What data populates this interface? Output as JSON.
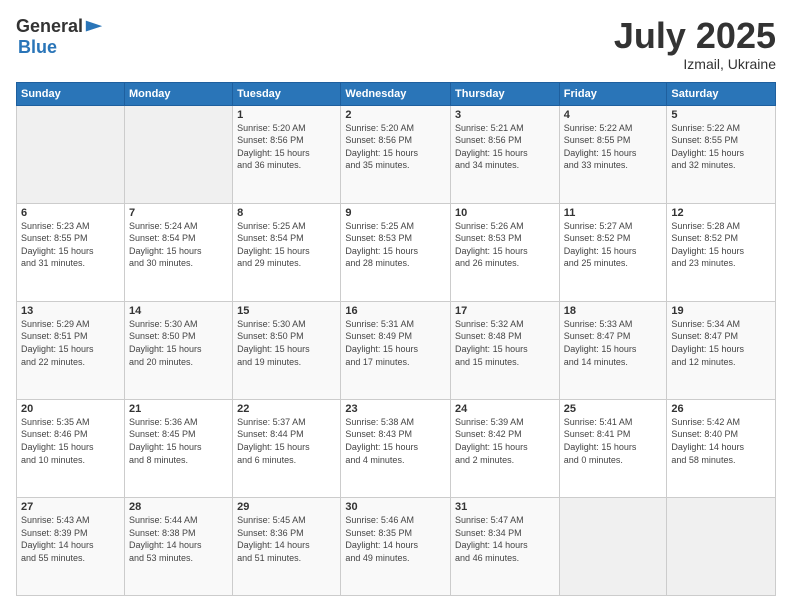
{
  "header": {
    "logo_general": "General",
    "logo_blue": "Blue",
    "title": "July 2025",
    "location": "Izmail, Ukraine"
  },
  "calendar": {
    "days_header": [
      "Sunday",
      "Monday",
      "Tuesday",
      "Wednesday",
      "Thursday",
      "Friday",
      "Saturday"
    ],
    "weeks": [
      [
        {
          "day": "",
          "info": ""
        },
        {
          "day": "",
          "info": ""
        },
        {
          "day": "1",
          "info": "Sunrise: 5:20 AM\nSunset: 8:56 PM\nDaylight: 15 hours\nand 36 minutes."
        },
        {
          "day": "2",
          "info": "Sunrise: 5:20 AM\nSunset: 8:56 PM\nDaylight: 15 hours\nand 35 minutes."
        },
        {
          "day": "3",
          "info": "Sunrise: 5:21 AM\nSunset: 8:56 PM\nDaylight: 15 hours\nand 34 minutes."
        },
        {
          "day": "4",
          "info": "Sunrise: 5:22 AM\nSunset: 8:55 PM\nDaylight: 15 hours\nand 33 minutes."
        },
        {
          "day": "5",
          "info": "Sunrise: 5:22 AM\nSunset: 8:55 PM\nDaylight: 15 hours\nand 32 minutes."
        }
      ],
      [
        {
          "day": "6",
          "info": "Sunrise: 5:23 AM\nSunset: 8:55 PM\nDaylight: 15 hours\nand 31 minutes."
        },
        {
          "day": "7",
          "info": "Sunrise: 5:24 AM\nSunset: 8:54 PM\nDaylight: 15 hours\nand 30 minutes."
        },
        {
          "day": "8",
          "info": "Sunrise: 5:25 AM\nSunset: 8:54 PM\nDaylight: 15 hours\nand 29 minutes."
        },
        {
          "day": "9",
          "info": "Sunrise: 5:25 AM\nSunset: 8:53 PM\nDaylight: 15 hours\nand 28 minutes."
        },
        {
          "day": "10",
          "info": "Sunrise: 5:26 AM\nSunset: 8:53 PM\nDaylight: 15 hours\nand 26 minutes."
        },
        {
          "day": "11",
          "info": "Sunrise: 5:27 AM\nSunset: 8:52 PM\nDaylight: 15 hours\nand 25 minutes."
        },
        {
          "day": "12",
          "info": "Sunrise: 5:28 AM\nSunset: 8:52 PM\nDaylight: 15 hours\nand 23 minutes."
        }
      ],
      [
        {
          "day": "13",
          "info": "Sunrise: 5:29 AM\nSunset: 8:51 PM\nDaylight: 15 hours\nand 22 minutes."
        },
        {
          "day": "14",
          "info": "Sunrise: 5:30 AM\nSunset: 8:50 PM\nDaylight: 15 hours\nand 20 minutes."
        },
        {
          "day": "15",
          "info": "Sunrise: 5:30 AM\nSunset: 8:50 PM\nDaylight: 15 hours\nand 19 minutes."
        },
        {
          "day": "16",
          "info": "Sunrise: 5:31 AM\nSunset: 8:49 PM\nDaylight: 15 hours\nand 17 minutes."
        },
        {
          "day": "17",
          "info": "Sunrise: 5:32 AM\nSunset: 8:48 PM\nDaylight: 15 hours\nand 15 minutes."
        },
        {
          "day": "18",
          "info": "Sunrise: 5:33 AM\nSunset: 8:47 PM\nDaylight: 15 hours\nand 14 minutes."
        },
        {
          "day": "19",
          "info": "Sunrise: 5:34 AM\nSunset: 8:47 PM\nDaylight: 15 hours\nand 12 minutes."
        }
      ],
      [
        {
          "day": "20",
          "info": "Sunrise: 5:35 AM\nSunset: 8:46 PM\nDaylight: 15 hours\nand 10 minutes."
        },
        {
          "day": "21",
          "info": "Sunrise: 5:36 AM\nSunset: 8:45 PM\nDaylight: 15 hours\nand 8 minutes."
        },
        {
          "day": "22",
          "info": "Sunrise: 5:37 AM\nSunset: 8:44 PM\nDaylight: 15 hours\nand 6 minutes."
        },
        {
          "day": "23",
          "info": "Sunrise: 5:38 AM\nSunset: 8:43 PM\nDaylight: 15 hours\nand 4 minutes."
        },
        {
          "day": "24",
          "info": "Sunrise: 5:39 AM\nSunset: 8:42 PM\nDaylight: 15 hours\nand 2 minutes."
        },
        {
          "day": "25",
          "info": "Sunrise: 5:41 AM\nSunset: 8:41 PM\nDaylight: 15 hours\nand 0 minutes."
        },
        {
          "day": "26",
          "info": "Sunrise: 5:42 AM\nSunset: 8:40 PM\nDaylight: 14 hours\nand 58 minutes."
        }
      ],
      [
        {
          "day": "27",
          "info": "Sunrise: 5:43 AM\nSunset: 8:39 PM\nDaylight: 14 hours\nand 55 minutes."
        },
        {
          "day": "28",
          "info": "Sunrise: 5:44 AM\nSunset: 8:38 PM\nDaylight: 14 hours\nand 53 minutes."
        },
        {
          "day": "29",
          "info": "Sunrise: 5:45 AM\nSunset: 8:36 PM\nDaylight: 14 hours\nand 51 minutes."
        },
        {
          "day": "30",
          "info": "Sunrise: 5:46 AM\nSunset: 8:35 PM\nDaylight: 14 hours\nand 49 minutes."
        },
        {
          "day": "31",
          "info": "Sunrise: 5:47 AM\nSunset: 8:34 PM\nDaylight: 14 hours\nand 46 minutes."
        },
        {
          "day": "",
          "info": ""
        },
        {
          "day": "",
          "info": ""
        }
      ]
    ]
  }
}
